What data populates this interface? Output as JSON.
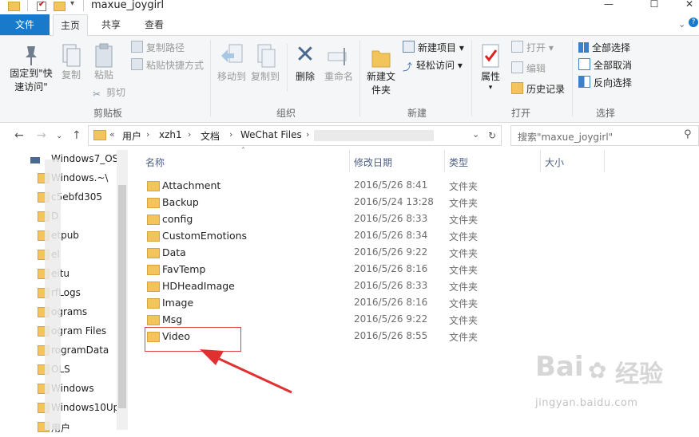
{
  "window": {
    "title": "maxue_joygirl",
    "controls": [
      "—",
      "☐",
      "✕"
    ]
  },
  "ribbon_tabs": [
    "文件",
    "主页",
    "共享",
    "查看"
  ],
  "ribbon": {
    "clipboard": {
      "pin_label": "固定到\"快速访问\"",
      "copy_label": "复制",
      "paste_label": "粘贴",
      "copy_path": "复制路径",
      "paste_shortcut": "粘贴快捷方式",
      "cut": "剪切",
      "group": "剪贴板"
    },
    "organize": {
      "move_to": "移动到",
      "copy_to": "复制到",
      "delete": "删除",
      "rename": "重命名",
      "group": "组织"
    },
    "new": {
      "new_folder": "新建文件夹",
      "new_item": "新建项目",
      "easy_access": "轻松访问",
      "group": "新建"
    },
    "open": {
      "properties": "属性",
      "open": "打开",
      "edit": "编辑",
      "history": "历史记录",
      "group": "打开"
    },
    "select": {
      "select_all": "全部选择",
      "select_none": "全部取消",
      "invert": "反向选择",
      "group": "选择"
    }
  },
  "address": {
    "prefix": "«",
    "crumbs": [
      "用户",
      "xzh1",
      "文档",
      "WeChat Files"
    ],
    "search_placeholder": "搜索\"maxue_joygirl\""
  },
  "nav_pane": [
    "Windows7_OS",
    "Windows.~\\",
    "c5ebfd305",
    "D",
    "etpub",
    "el",
    "eitu",
    "rfLogs",
    "ograms",
    "ogram Files",
    "rogramData",
    "OLS",
    "Windows",
    "Windows10Up",
    "用户"
  ],
  "columns": [
    "名称",
    "修改日期",
    "类型",
    "大小"
  ],
  "files": [
    {
      "name": "Attachment",
      "date": "2016/5/26 8:41",
      "type": "文件夹"
    },
    {
      "name": "Backup",
      "date": "2016/5/24 13:28",
      "type": "文件夹"
    },
    {
      "name": "config",
      "date": "2016/5/26 8:33",
      "type": "文件夹"
    },
    {
      "name": "CustomEmotions",
      "date": "2016/5/26 8:34",
      "type": "文件夹"
    },
    {
      "name": "Data",
      "date": "2016/5/26 9:22",
      "type": "文件夹"
    },
    {
      "name": "FavTemp",
      "date": "2016/5/26 8:16",
      "type": "文件夹"
    },
    {
      "name": "HDHeadImage",
      "date": "2016/5/26 8:33",
      "type": "文件夹"
    },
    {
      "name": "Image",
      "date": "2016/5/26 8:16",
      "type": "文件夹"
    },
    {
      "name": "Msg",
      "date": "2016/5/26 9:22",
      "type": "文件夹"
    },
    {
      "name": "Video",
      "date": "2016/5/26 8:55",
      "type": "文件夹"
    }
  ],
  "watermark": {
    "brand": "Bai",
    "brand_cn": "经验",
    "url": "jingyan.baidu.com"
  },
  "colors": {
    "file_tab": "#1979ca",
    "folder": "#f2c55c",
    "highlight": "#e04040"
  }
}
